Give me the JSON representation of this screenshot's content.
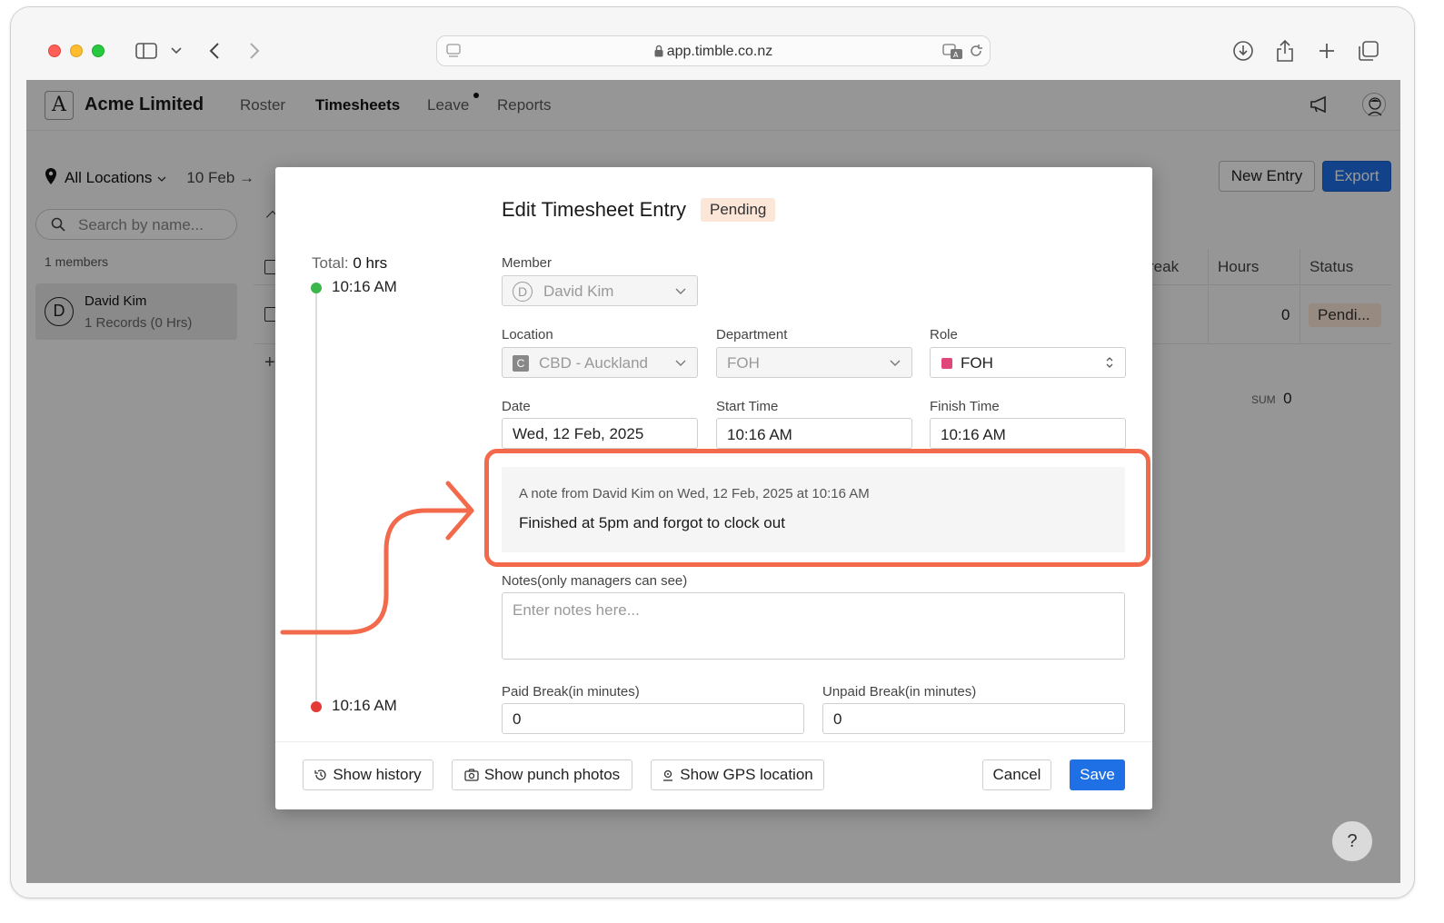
{
  "browser": {
    "url": "app.timble.co.nz"
  },
  "app": {
    "company": "Acme Limited",
    "nav": [
      {
        "label": "Roster"
      },
      {
        "label": "Timesheets"
      },
      {
        "label": "Leave"
      },
      {
        "label": "Reports"
      }
    ]
  },
  "toolbar": {
    "location_filter": "All Locations",
    "date_range": "10 Feb →",
    "new_entry": "New Entry",
    "export": "Export"
  },
  "sidebar": {
    "search_placeholder": "Search by name...",
    "members_count": "1 members",
    "member": {
      "initial": "D",
      "name": "David Kim",
      "records": "1 Records (0 Hrs)"
    }
  },
  "table": {
    "headers": [
      "reak",
      "Hours",
      "Status"
    ],
    "row": {
      "hours": "0",
      "status": "Pendi..."
    },
    "sum_label": "SUM",
    "sum_value": "0"
  },
  "modal": {
    "title": "Edit Timesheet Entry",
    "status_badge": "Pending",
    "timeline": {
      "total_label": "Total:",
      "total_value": "0 hrs",
      "start": "10:16 AM",
      "end": "10:16 AM"
    },
    "member": {
      "label": "Member",
      "initial": "D",
      "value": "David Kim"
    },
    "location": {
      "label": "Location",
      "initial": "C",
      "value": "CBD - Auckland"
    },
    "department": {
      "label": "Department",
      "value": "FOH"
    },
    "role": {
      "label": "Role",
      "value": "FOH",
      "color": "#e0457b"
    },
    "date": {
      "label": "Date",
      "value": "Wed, 12 Feb, 2025"
    },
    "start_time": {
      "label": "Start Time",
      "value": "10:16 AM"
    },
    "finish_time": {
      "label": "Finish Time",
      "value": "10:16 AM"
    },
    "note": {
      "meta": "A note from David Kim on Wed, 12 Feb, 2025 at 10:16 AM",
      "text": "Finished at 5pm and forgot to clock out"
    },
    "notes": {
      "label": "Notes(only managers can see)",
      "placeholder": "Enter notes here..."
    },
    "paid_break": {
      "label": "Paid Break(in minutes)",
      "value": "0"
    },
    "unpaid_break": {
      "label": "Unpaid Break(in minutes)",
      "value": "0"
    },
    "buttons": {
      "history": "Show history",
      "punch_photos": "Show punch photos",
      "gps": "Show GPS location",
      "cancel": "Cancel",
      "save": "Save"
    }
  },
  "help": "?",
  "colors": {
    "accent": "#1f6fe5",
    "highlight": "#f26a4b",
    "start_dot": "#3cb54a",
    "end_dot": "#e53935"
  }
}
